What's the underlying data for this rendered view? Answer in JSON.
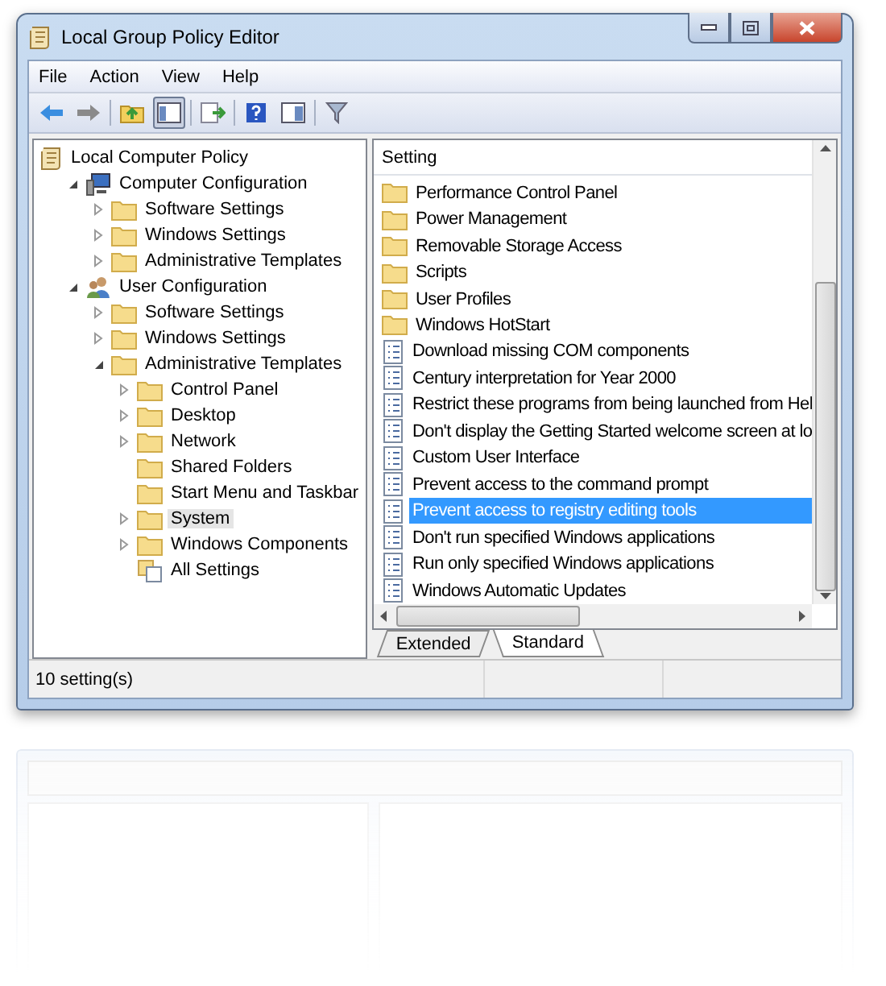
{
  "window": {
    "title": "Local Group Policy Editor"
  },
  "menu": [
    "File",
    "Action",
    "View",
    "Help"
  ],
  "toolbar": [
    {
      "kind": "back",
      "pressed": false
    },
    {
      "kind": "forward",
      "pressed": false
    },
    {
      "kind": "sep"
    },
    {
      "kind": "up",
      "pressed": false
    },
    {
      "kind": "tree",
      "pressed": true
    },
    {
      "kind": "sep"
    },
    {
      "kind": "export",
      "pressed": false
    },
    {
      "kind": "sep"
    },
    {
      "kind": "help",
      "pressed": false
    },
    {
      "kind": "pane",
      "pressed": false
    },
    {
      "kind": "sep"
    },
    {
      "kind": "filter",
      "pressed": false
    }
  ],
  "tree": [
    {
      "label": "Local Computer Policy",
      "kind": "policy",
      "selected": false,
      "children": [
        {
          "label": "Computer Configuration",
          "kind": "computer",
          "expanded": true,
          "selected": false,
          "children": [
            {
              "label": "Software Settings",
              "kind": "folder",
              "expanded": false,
              "selected": false
            },
            {
              "label": "Windows Settings",
              "kind": "folder",
              "expanded": false,
              "selected": false
            },
            {
              "label": "Administrative Templates",
              "kind": "folder",
              "expanded": false,
              "selected": false
            }
          ]
        },
        {
          "label": "User Configuration",
          "kind": "user",
          "expanded": true,
          "selected": false,
          "children": [
            {
              "label": "Software Settings",
              "kind": "folder",
              "expanded": false,
              "selected": false
            },
            {
              "label": "Windows Settings",
              "kind": "folder",
              "expanded": false,
              "selected": false
            },
            {
              "label": "Administrative Templates",
              "kind": "folder",
              "expanded": true,
              "selected": false,
              "children": [
                {
                  "label": "Control Panel",
                  "kind": "folder",
                  "expanded": false,
                  "selected": false
                },
                {
                  "label": "Desktop",
                  "kind": "folder",
                  "expanded": false,
                  "selected": false
                },
                {
                  "label": "Network",
                  "kind": "folder",
                  "expanded": false,
                  "selected": false
                },
                {
                  "label": "Shared Folders",
                  "kind": "folder",
                  "leaf": true,
                  "selected": false
                },
                {
                  "label": "Start Menu and Taskbar",
                  "kind": "folder",
                  "leaf": true,
                  "selected": false
                },
                {
                  "label": "System",
                  "kind": "folder",
                  "expanded": false,
                  "selected": true
                },
                {
                  "label": "Windows Components",
                  "kind": "folder",
                  "expanded": false,
                  "selected": false
                },
                {
                  "label": "All Settings",
                  "kind": "all",
                  "leaf": true,
                  "selected": false
                }
              ]
            }
          ]
        }
      ]
    }
  ],
  "list": {
    "column": "Setting",
    "rows": [
      {
        "label": "Performance Control Panel",
        "kind": "folder",
        "selected": false
      },
      {
        "label": "Power Management",
        "kind": "folder",
        "selected": false
      },
      {
        "label": "Removable Storage Access",
        "kind": "folder",
        "selected": false
      },
      {
        "label": "Scripts",
        "kind": "folder",
        "selected": false
      },
      {
        "label": "User Profiles",
        "kind": "folder",
        "selected": false
      },
      {
        "label": "Windows HotStart",
        "kind": "folder",
        "selected": false
      },
      {
        "label": "Download missing COM components",
        "kind": "setting",
        "selected": false
      },
      {
        "label": "Century interpretation for Year 2000",
        "kind": "setting",
        "selected": false
      },
      {
        "label": "Restrict these programs from being launched from Hel",
        "kind": "setting",
        "selected": false
      },
      {
        "label": "Don't display the Getting Started welcome screen at lo",
        "kind": "setting",
        "selected": false
      },
      {
        "label": "Custom User Interface",
        "kind": "setting",
        "selected": false
      },
      {
        "label": "Prevent access to the command prompt",
        "kind": "setting",
        "selected": false
      },
      {
        "label": "Prevent access to registry editing tools",
        "kind": "setting",
        "selected": true
      },
      {
        "label": "Don't run specified Windows applications",
        "kind": "setting",
        "selected": false
      },
      {
        "label": "Run only specified Windows applications",
        "kind": "setting",
        "selected": false
      },
      {
        "label": "Windows Automatic Updates",
        "kind": "setting",
        "selected": false
      }
    ]
  },
  "view_tabs": [
    {
      "label": "Extended",
      "selected": false
    },
    {
      "label": "Standard",
      "selected": true
    }
  ],
  "status_bar": "10 setting(s)"
}
